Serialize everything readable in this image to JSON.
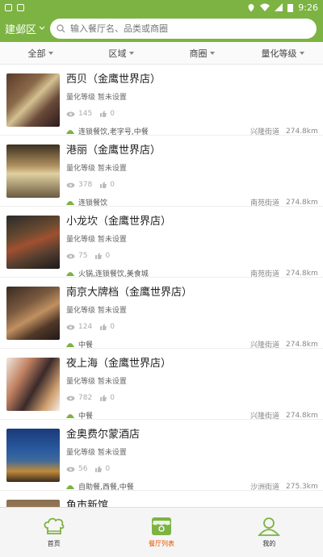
{
  "status": {
    "time": "9:26"
  },
  "header": {
    "city": "建邺区",
    "search_placeholder": "输入餐厅名、品类或商圈"
  },
  "filters": [
    {
      "label": "全部"
    },
    {
      "label": "区域"
    },
    {
      "label": "商圈"
    },
    {
      "label": "量化等级"
    }
  ],
  "restaurants": [
    {
      "name": "西贝（金鹰世界店）",
      "quality": "量化等级 暂未设置",
      "views": "145",
      "likes": "0",
      "category": "连锁餐饮,老字号,中餐",
      "street": "兴隆街道",
      "distance": "274.8km"
    },
    {
      "name": "港丽（金鹰世界店）",
      "quality": "量化等级 暂未设置",
      "views": "378",
      "likes": "0",
      "category": "连锁餐饮",
      "street": "南苑街道",
      "distance": "274.8km"
    },
    {
      "name": "小龙坎（金鹰世界店）",
      "quality": "量化等级 暂未设置",
      "views": "75",
      "likes": "0",
      "category": "火锅,连锁餐饮,美食城",
      "street": "南苑街道",
      "distance": "274.8km"
    },
    {
      "name": "南京大牌档（金鹰世界店）",
      "quality": "量化等级 暂未设置",
      "views": "124",
      "likes": "0",
      "category": "中餐",
      "street": "兴隆街道",
      "distance": "274.8km"
    },
    {
      "name": "夜上海（金鹰世界店）",
      "quality": "量化等级 暂未设置",
      "views": "782",
      "likes": "0",
      "category": "中餐",
      "street": "兴隆街道",
      "distance": "274.8km"
    },
    {
      "name": "金奥费尔蒙酒店",
      "quality": "量化等级 暂未设置",
      "views": "56",
      "likes": "0",
      "category": "自助餐,西餐,中餐",
      "street": "沙洲街道",
      "distance": "275.3km"
    },
    {
      "name": "鱼市新馆",
      "quality": "",
      "views": "",
      "likes": "",
      "category": "",
      "street": "",
      "distance": ""
    }
  ],
  "tabs": [
    {
      "label": "首页"
    },
    {
      "label": "餐厅列表"
    },
    {
      "label": "我的"
    }
  ],
  "colors": {
    "accent": "#7cb342",
    "active_tab": "#e65100"
  }
}
